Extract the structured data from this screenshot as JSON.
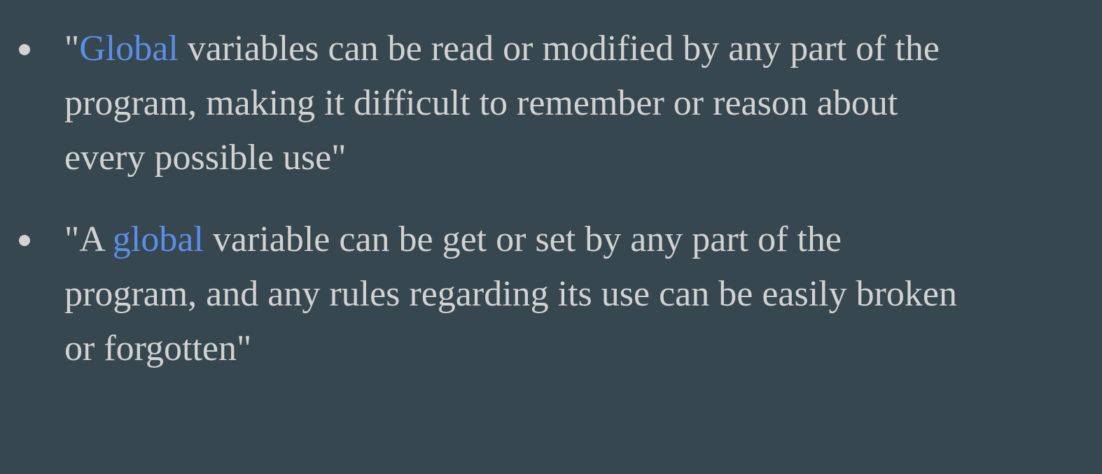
{
  "items": [
    {
      "lines": [
        {
          "pre": "\"",
          "highlight": "Global",
          "post": " variables can be read or modified by any part of the"
        },
        {
          "text": "program, making it difficult to remember or reason about"
        },
        {
          "text": "every possible use\""
        }
      ]
    },
    {
      "lines": [
        {
          "pre": "\"A ",
          "highlight": "global",
          "post": " variable can be get or set by any part of the"
        },
        {
          "text": "program, and any rules regarding its use can be easily broken"
        },
        {
          "text": "or forgotten\""
        }
      ]
    }
  ],
  "colors": {
    "background": "#37474f",
    "text": "#d2d2d2",
    "highlight": "#5a8ee8"
  }
}
